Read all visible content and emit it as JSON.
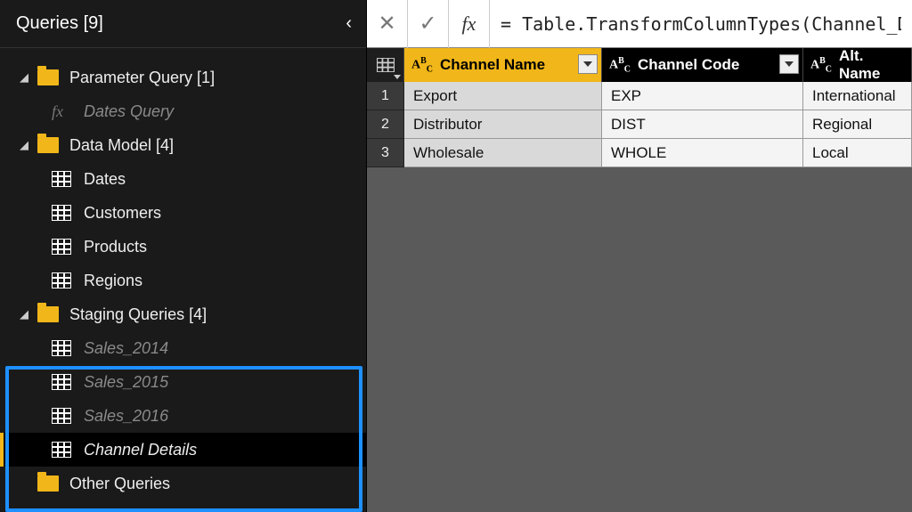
{
  "sidebar": {
    "title": "Queries [9]",
    "groups": [
      {
        "label": "Parameter Query [1]"
      },
      {
        "label": "Dates Query"
      },
      {
        "label": "Data Model [4]"
      },
      {
        "label": "Dates"
      },
      {
        "label": "Customers"
      },
      {
        "label": "Products"
      },
      {
        "label": "Regions"
      },
      {
        "label": "Staging Queries [4]"
      },
      {
        "label": "Sales_2014"
      },
      {
        "label": "Sales_2015"
      },
      {
        "label": "Sales_2016"
      },
      {
        "label": "Channel Details"
      },
      {
        "label": "Other Queries"
      }
    ]
  },
  "formula": "= Table.TransformColumnTypes(Channel_Deta",
  "columns": {
    "c1": "Channel Name",
    "c2": "Channel Code",
    "c3": "Alt. Name"
  },
  "rows": [
    {
      "n": "1",
      "name": "Export",
      "code": "EXP",
      "alt": "International"
    },
    {
      "n": "2",
      "name": "Distributor",
      "code": "DIST",
      "alt": "Regional"
    },
    {
      "n": "3",
      "name": "Wholesale",
      "code": "WHOLE",
      "alt": "Local"
    }
  ]
}
